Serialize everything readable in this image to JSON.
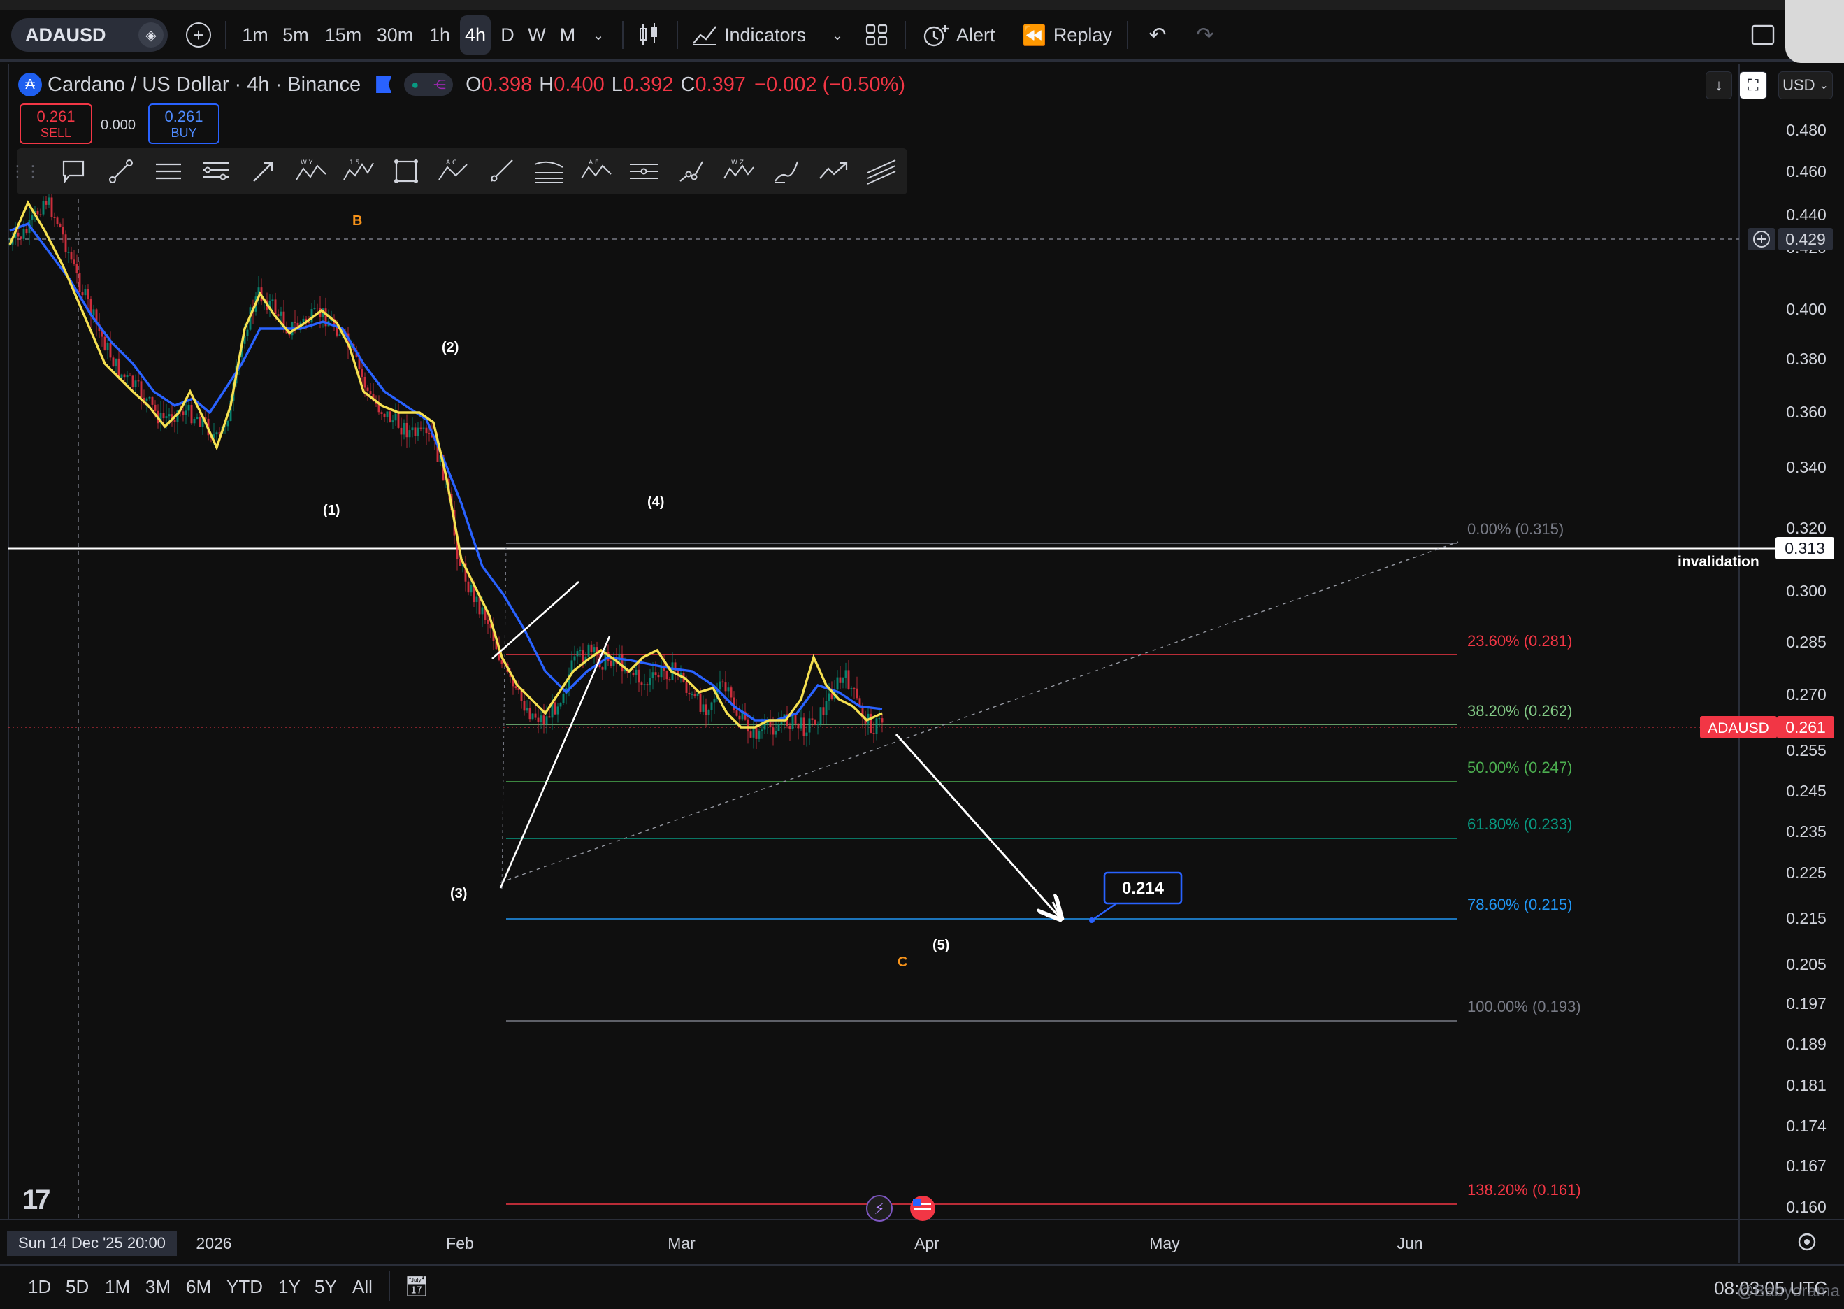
{
  "toolbar": {
    "symbol": "ADAUSD",
    "intervals": [
      "1m",
      "5m",
      "15m",
      "30m",
      "1h",
      "4h",
      "D",
      "W",
      "M"
    ],
    "active_interval": "4h",
    "indicators_label": "Indicators",
    "alert_label": "Alert",
    "replay_label": "Replay"
  },
  "header": {
    "title": "Cardano / US Dollar · 4h · Binance",
    "open_key": "O",
    "open": "0.398",
    "high_key": "H",
    "high": "0.400",
    "low_key": "L",
    "low": "0.392",
    "close_key": "C",
    "close": "0.397",
    "change": "−0.002 (−0.50%)",
    "sell_price": "0.261",
    "sell_label": "SELL",
    "buy_price": "0.261",
    "buy_label": "BUY",
    "spread": "0.000",
    "currency": "USD"
  },
  "price_axis": {
    "ticks": [
      "0.480",
      "0.460",
      "0.440",
      "0.420",
      "0.400",
      "0.380",
      "0.360",
      "0.340",
      "0.320",
      "0.300",
      "0.285",
      "0.270",
      "0.255",
      "0.245",
      "0.235",
      "0.225",
      "0.215",
      "0.205",
      "0.197",
      "0.189",
      "0.181",
      "0.174",
      "0.167",
      "0.160"
    ],
    "crosshair_price": "0.429",
    "invalidation_price": "0.313",
    "invalidation_label": "invalidation",
    "current_symbol": "ADAUSD",
    "current_price": "0.261"
  },
  "time_axis": {
    "labels": [
      "2026",
      "Feb",
      "Mar",
      "Apr",
      "May",
      "Jun"
    ],
    "crosshair_date": "Sun 14 Dec '25   20:00"
  },
  "fib_levels": [
    {
      "label": "0.00% (0.315)",
      "color": "#787b86"
    },
    {
      "label": "23.60% (0.281)",
      "color": "#f23645"
    },
    {
      "label": "38.20% (0.262)",
      "color": "#81c784"
    },
    {
      "label": "50.00% (0.247)",
      "color": "#4caf50"
    },
    {
      "label": "61.80% (0.233)",
      "color": "#089981"
    },
    {
      "label": "78.60% (0.215)",
      "color": "#2196f3"
    },
    {
      "label": "100.00% (0.193)",
      "color": "#787b86"
    },
    {
      "label": "138.20% (0.161)",
      "color": "#f23645"
    }
  ],
  "wave_labels": {
    "b": "B",
    "w1": "(1)",
    "w2": "(2)",
    "w3": "(3)",
    "w4": "(4)",
    "w5": "(5)",
    "c": "C"
  },
  "target": {
    "label": "0.214"
  },
  "bottom": {
    "ranges": [
      "1D",
      "5D",
      "1M",
      "3M",
      "6M",
      "YTD",
      "1Y",
      "5Y",
      "All"
    ],
    "time": "08:03:05 UTC",
    "watermark": "@Babyorama"
  },
  "colors": {
    "ema_fast": "#f5e050",
    "ema_slow": "#2962ff",
    "up": "#089981",
    "down": "#f23645",
    "accent": "#2962ff"
  }
}
